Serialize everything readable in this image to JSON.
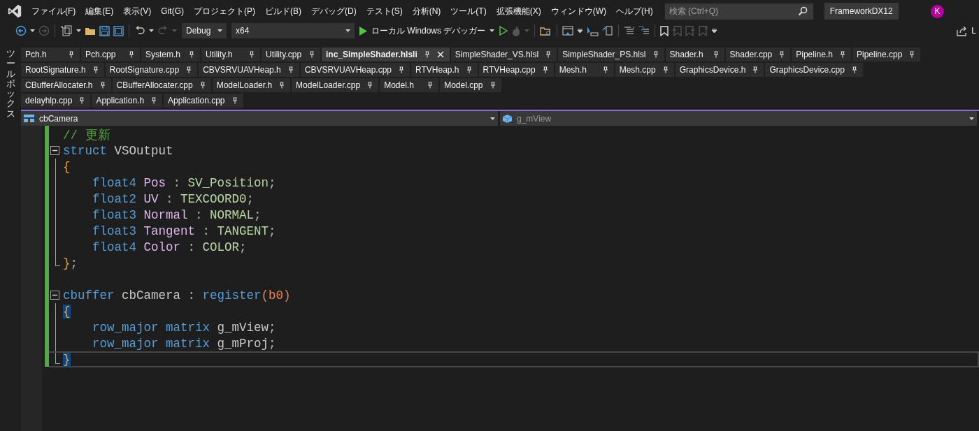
{
  "menu": [
    "ファイル(F)",
    "編集(E)",
    "表示(V)",
    "Git(G)",
    "プロジェクト(P)",
    "ビルド(B)",
    "デバッグ(D)",
    "テスト(S)",
    "分析(N)",
    "ツール(T)",
    "拡張機能(X)",
    "ウィンドウ(W)",
    "ヘルプ(H)"
  ],
  "search": {
    "placeholder": "検索 (Ctrl+Q)"
  },
  "solution_name": "FrameworkDX12",
  "avatar": "K",
  "toolbar": {
    "configuration": "Debug",
    "platform": "x64",
    "run_label": "ローカル Windows デバッガー",
    "share_label": "L"
  },
  "toolbox_label": "ツールボックス",
  "tab_rows": [
    [
      {
        "label": "Pch.h",
        "selected": false
      },
      {
        "label": "Pch.cpp",
        "selected": false
      },
      {
        "label": "System.h",
        "selected": false
      },
      {
        "label": "Utility.h",
        "selected": false
      },
      {
        "label": "Utility.cpp",
        "selected": false
      },
      {
        "label": "inc_SimpleShader.hlsli",
        "selected": true
      },
      {
        "label": "SimpleShader_VS.hlsl",
        "selected": false
      },
      {
        "label": "SimpleShader_PS.hlsl",
        "selected": false
      },
      {
        "label": "Shader.h",
        "selected": false
      },
      {
        "label": "Shader.cpp",
        "selected": false
      },
      {
        "label": "Pipeline.h",
        "selected": false
      },
      {
        "label": "Pipeline.cpp",
        "selected": false
      }
    ],
    [
      {
        "label": "RootSignature.h",
        "selected": false
      },
      {
        "label": "RootSignature.cpp",
        "selected": false
      },
      {
        "label": "CBVSRVUAVHeap.h",
        "selected": false
      },
      {
        "label": "CBVSRVUAVHeap.cpp",
        "selected": false
      },
      {
        "label": "RTVHeap.h",
        "selected": false
      },
      {
        "label": "RTVHeap.cpp",
        "selected": false
      },
      {
        "label": "Mesh.h",
        "selected": false
      },
      {
        "label": "Mesh.cpp",
        "selected": false
      },
      {
        "label": "GraphicsDevice.h",
        "selected": false
      },
      {
        "label": "GraphicsDevice.cpp",
        "selected": false
      }
    ],
    [
      {
        "label": "CBufferAllocater.h",
        "selected": false
      },
      {
        "label": "CBufferAllocater.cpp",
        "selected": false
      },
      {
        "label": "ModelLoader.h",
        "selected": false
      },
      {
        "label": "ModelLoader.cpp",
        "selected": false
      },
      {
        "label": "Model.h",
        "selected": false
      },
      {
        "label": "Model.cpp",
        "selected": false
      }
    ],
    [
      {
        "label": "delayhlp.cpp",
        "selected": false
      },
      {
        "label": "Application.h",
        "selected": false
      },
      {
        "label": "Application.cpp",
        "selected": false
      }
    ]
  ],
  "nav": {
    "scope": "cbCamera",
    "member": "g_mView"
  },
  "code": [
    {
      "kind": "plain",
      "tokens": [
        {
          "kind": "comment",
          "text": "// 更新"
        }
      ]
    },
    {
      "kind": "block-start",
      "tokens": [
        {
          "kind": "keyword",
          "text": "struct"
        },
        {
          "kind": "ident",
          "text": "VSOutput"
        }
      ]
    },
    {
      "kind": "block",
      "tokens": [
        {
          "kind": "brace",
          "text": "{"
        }
      ]
    },
    {
      "kind": "block-member",
      "tokens": [
        {
          "kind": "keyword",
          "text": "float4"
        },
        {
          "kind": "field",
          "text": "Pos"
        },
        {
          "kind": "punct",
          "text": ":"
        },
        {
          "kind": "semantic",
          "text": "SV_Position"
        },
        {
          "kind": "terminator",
          "text": ";"
        }
      ]
    },
    {
      "kind": "block-member",
      "tokens": [
        {
          "kind": "keyword",
          "text": "float2"
        },
        {
          "kind": "field",
          "text": "UV"
        },
        {
          "kind": "punct",
          "text": ":"
        },
        {
          "kind": "semantic",
          "text": "TEXCOORD0"
        },
        {
          "kind": "terminator",
          "text": ";"
        }
      ]
    },
    {
      "kind": "block-member",
      "tokens": [
        {
          "kind": "keyword",
          "text": "float3"
        },
        {
          "kind": "field",
          "text": "Normal"
        },
        {
          "kind": "punct",
          "text": ":"
        },
        {
          "kind": "semantic",
          "text": "NORMAL"
        },
        {
          "kind": "terminator",
          "text": ";"
        }
      ]
    },
    {
      "kind": "block-member",
      "tokens": [
        {
          "kind": "keyword",
          "text": "float3"
        },
        {
          "kind": "field",
          "text": "Tangent"
        },
        {
          "kind": "punct",
          "text": ":"
        },
        {
          "kind": "semantic",
          "text": "TANGENT"
        },
        {
          "kind": "terminator",
          "text": ";"
        }
      ]
    },
    {
      "kind": "block-member",
      "tokens": [
        {
          "kind": "keyword",
          "text": "float4"
        },
        {
          "kind": "field",
          "text": "Color"
        },
        {
          "kind": "punct",
          "text": ":"
        },
        {
          "kind": "semantic",
          "text": "COLOR"
        },
        {
          "kind": "terminator",
          "text": ";"
        }
      ]
    },
    {
      "kind": "block-end",
      "tokens": [
        {
          "kind": "brace",
          "text": "}"
        },
        {
          "kind": "terminator",
          "text": ";"
        }
      ]
    },
    {
      "kind": "blank"
    },
    {
      "kind": "block-start",
      "tokens": [
        {
          "kind": "keyword",
          "text": "cbuffer"
        },
        {
          "kind": "ident",
          "text": "cbCamera"
        },
        {
          "kind": "punct",
          "text": ":"
        },
        {
          "kind": "keyword",
          "text": "register"
        },
        {
          "kind": "register",
          "text": "(b0)"
        }
      ]
    },
    {
      "kind": "block",
      "tokens": [
        {
          "kind": "brace-match",
          "text": "{"
        }
      ]
    },
    {
      "kind": "block-member",
      "tokens": [
        {
          "kind": "keyword",
          "text": "row_major"
        },
        {
          "kind": "keyword",
          "text": "matrix"
        },
        {
          "kind": "ident",
          "text": "g_mView"
        },
        {
          "kind": "terminator",
          "text": ";"
        }
      ]
    },
    {
      "kind": "block-member",
      "tokens": [
        {
          "kind": "keyword",
          "text": "row_major"
        },
        {
          "kind": "keyword",
          "text": "matrix"
        },
        {
          "kind": "ident",
          "text": "g_mProj"
        },
        {
          "kind": "terminator",
          "text": ";"
        }
      ]
    },
    {
      "kind": "block-end",
      "current": true,
      "tokens": [
        {
          "kind": "brace-match",
          "text": "}"
        }
      ]
    }
  ]
}
